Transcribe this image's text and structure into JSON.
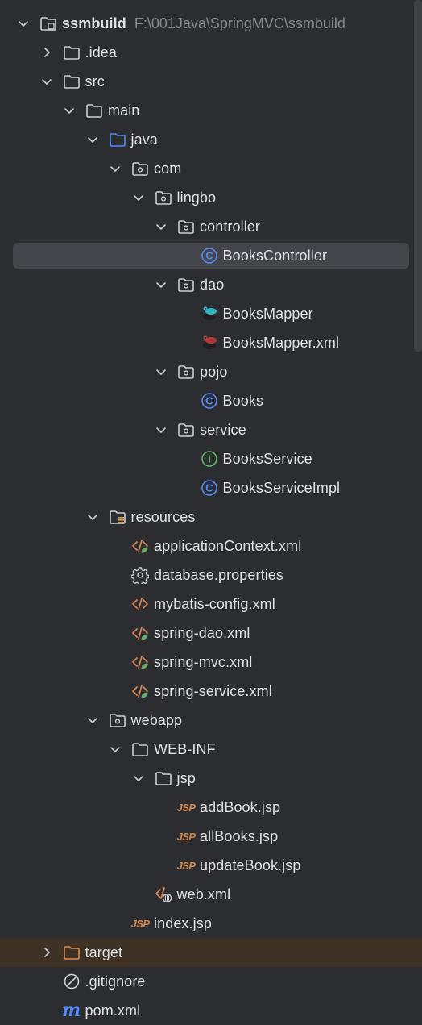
{
  "project_tree": {
    "rows": [
      {
        "label": "ssmbuild",
        "path": "F:\\001Java\\SpringMVC\\ssmbuild",
        "icon": "project-folder-icon",
        "depth": 0,
        "expanded": true
      },
      {
        "label": ".idea",
        "icon": "folder-icon",
        "depth": 1,
        "expanded": false
      },
      {
        "label": "src",
        "icon": "folder-icon",
        "depth": 1,
        "expanded": true
      },
      {
        "label": "main",
        "icon": "folder-icon",
        "depth": 2,
        "expanded": true
      },
      {
        "label": "java",
        "icon": "source-folder-icon",
        "depth": 3,
        "expanded": true
      },
      {
        "label": "com",
        "icon": "package-icon",
        "depth": 4,
        "expanded": true
      },
      {
        "label": "lingbo",
        "icon": "package-icon",
        "depth": 5,
        "expanded": true
      },
      {
        "label": "controller",
        "icon": "package-icon",
        "depth": 6,
        "expanded": true
      },
      {
        "label": "BooksController",
        "icon": "java-class-icon",
        "depth": 7,
        "selected": true
      },
      {
        "label": "dao",
        "icon": "package-icon",
        "depth": 6,
        "expanded": true
      },
      {
        "label": "BooksMapper",
        "icon": "mybatis-mapper-icon",
        "depth": 7
      },
      {
        "label": "BooksMapper.xml",
        "icon": "mybatis-xml-icon",
        "depth": 7
      },
      {
        "label": "pojo",
        "icon": "package-icon",
        "depth": 6,
        "expanded": true
      },
      {
        "label": "Books",
        "icon": "java-class-icon",
        "depth": 7
      },
      {
        "label": "service",
        "icon": "package-icon",
        "depth": 6,
        "expanded": true
      },
      {
        "label": "BooksService",
        "icon": "java-interface-icon",
        "depth": 7
      },
      {
        "label": "BooksServiceImpl",
        "icon": "java-class-icon",
        "depth": 7
      },
      {
        "label": "resources",
        "icon": "resources-folder-icon",
        "depth": 3,
        "expanded": true
      },
      {
        "label": "applicationContext.xml",
        "icon": "spring-xml-icon",
        "depth": 4
      },
      {
        "label": "database.properties",
        "icon": "gear-icon",
        "depth": 4
      },
      {
        "label": "mybatis-config.xml",
        "icon": "xml-icon",
        "depth": 4
      },
      {
        "label": "spring-dao.xml",
        "icon": "spring-xml-icon",
        "depth": 4
      },
      {
        "label": "spring-mvc.xml",
        "icon": "spring-xml-icon",
        "depth": 4
      },
      {
        "label": "spring-service.xml",
        "icon": "spring-xml-icon",
        "depth": 4
      },
      {
        "label": "webapp",
        "icon": "web-folder-icon",
        "depth": 3,
        "expanded": true
      },
      {
        "label": "WEB-INF",
        "icon": "folder-icon",
        "depth": 4,
        "expanded": true
      },
      {
        "label": "jsp",
        "icon": "folder-icon",
        "depth": 5,
        "expanded": true
      },
      {
        "label": "addBook.jsp",
        "icon": "jsp-icon",
        "depth": 6
      },
      {
        "label": "allBooks.jsp",
        "icon": "jsp-icon",
        "depth": 6
      },
      {
        "label": "updateBook.jsp",
        "icon": "jsp-icon",
        "depth": 6
      },
      {
        "label": "web.xml",
        "icon": "web-xml-icon",
        "depth": 5
      },
      {
        "label": "index.jsp",
        "icon": "jsp-icon",
        "depth": 4
      },
      {
        "label": "target",
        "icon": "excluded-folder-icon",
        "depth": 1,
        "expanded": false,
        "excluded": true
      },
      {
        "label": ".gitignore",
        "icon": "gitignore-icon",
        "depth": 1
      },
      {
        "label": "pom.xml",
        "icon": "maven-icon",
        "depth": 1
      }
    ]
  },
  "colors": {
    "background": "#2b2d30",
    "selected_row": "#43454a",
    "excluded_row": "#3d3223",
    "text": "#dfe1e5",
    "muted_text": "#868a91",
    "java_blue": "#548af7",
    "interface_green": "#5fb865",
    "xml_orange": "#e08855",
    "spring_green": "#6aab73"
  }
}
